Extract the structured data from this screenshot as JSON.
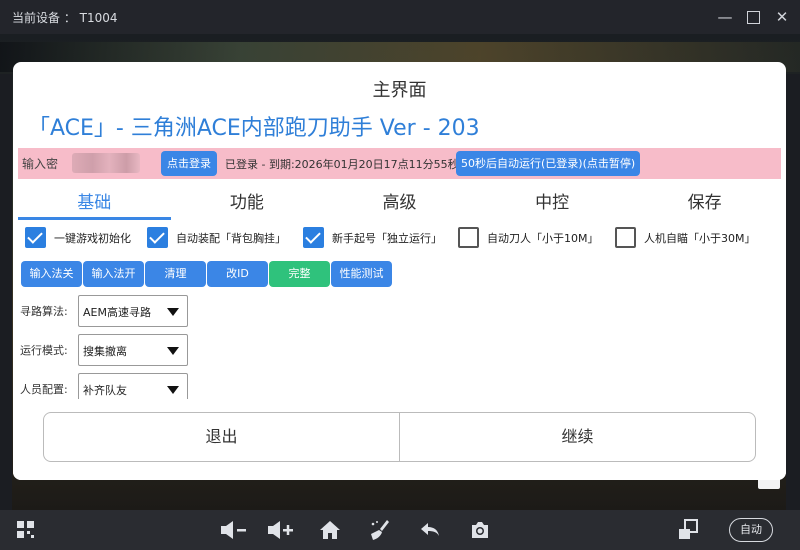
{
  "window": {
    "title": "当前设备 ： T1004",
    "controls": [
      "minimize",
      "maximize",
      "close"
    ]
  },
  "dialog": {
    "title": "主界面",
    "app_title": "「ACE」- 三角洲ACE内部跑刀助手  Ver - 203",
    "login": {
      "password_label": "输入密",
      "login_button": "点击登录",
      "status": "已登录 - 到期:2026年01月20日17点11分55秒",
      "auto_button": "50秒后自动运行(已登录)(点击暂停)"
    },
    "tabs": [
      {
        "label": "基础",
        "active": true
      },
      {
        "label": "功能",
        "active": false
      },
      {
        "label": "高级",
        "active": false
      },
      {
        "label": "中控",
        "active": false
      },
      {
        "label": "保存",
        "active": false
      }
    ],
    "checkboxes": [
      {
        "label": "一键游戏初始化",
        "checked": true
      },
      {
        "label": "自动装配「背包胸挂」",
        "checked": true
      },
      {
        "label": "新手起号「独立运行」",
        "checked": true
      },
      {
        "label": "自动刀人「小于10M」",
        "checked": false
      },
      {
        "label": "人机自瞄「小于30M」",
        "checked": false
      }
    ],
    "action_buttons": [
      {
        "label": "输入法关",
        "color": "#3b86e6"
      },
      {
        "label": "输入法开",
        "color": "#3b86e6"
      },
      {
        "label": "清理",
        "color": "#3b86e6"
      },
      {
        "label": "改ID",
        "color": "#3b86e6"
      },
      {
        "label": "完整",
        "color": "#2fc27c"
      },
      {
        "label": "性能测试",
        "color": "#3b86e6"
      }
    ],
    "selects": [
      {
        "label": "寻路算法:",
        "value": "AEM高速寻路"
      },
      {
        "label": "运行模式:",
        "value": "搜集撤离"
      },
      {
        "label": "人员配置:",
        "value": "补齐队友"
      }
    ],
    "exit_button": "退出",
    "continue_button": "继续"
  },
  "taskbar": {
    "icons": [
      "grid-icon",
      "volume-down-icon",
      "volume-up-icon",
      "home-icon",
      "clean-icon",
      "back-icon",
      "camera-icon",
      "rotate-icon"
    ],
    "auto_label": "自动"
  },
  "colors": {
    "accent": "#2f7fd8",
    "login_bar_bg": "#f7bcc9",
    "button_blue": "#3b86e6",
    "button_green": "#2fc27c"
  }
}
